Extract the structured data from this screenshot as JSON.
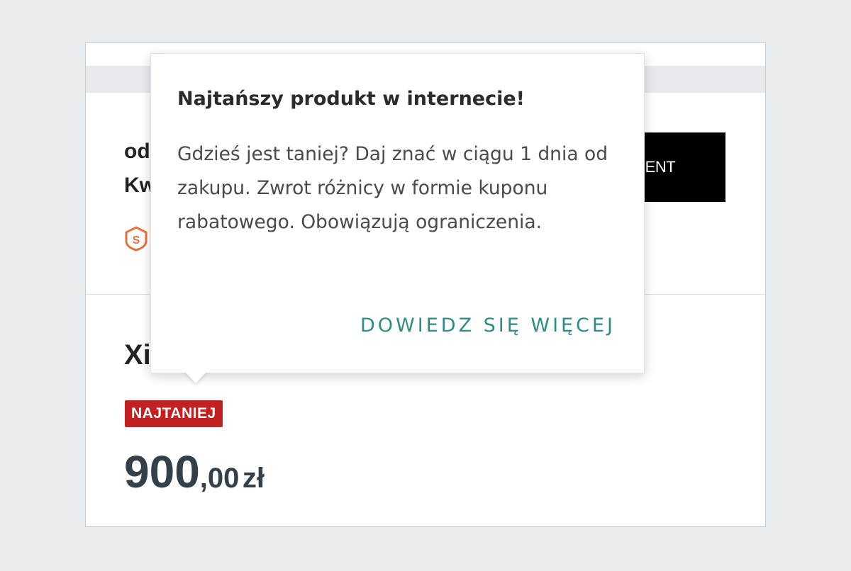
{
  "seller": {
    "line1": "od",
    "line2": "Kw",
    "badge_icon": "super-seller-shield-icon",
    "badge_letter": "S",
    "accent_color": "#e8703d"
  },
  "promo_button": {
    "label": "MENT"
  },
  "product": {
    "title": "Xi",
    "badge": "NAJTANIEJ",
    "badge_color": "#c22021",
    "price_integer": "900",
    "price_decimal": ",00",
    "currency": "zł"
  },
  "tooltip": {
    "title": "Najtańszy produkt w internecie!",
    "body": "Gdzieś jest taniej? Daj znać w ciągu 1 dnia od zakupu. Zwrot różnicy w formie kuponu rabatowego. Obowiązują ograniczenia.",
    "link": "DOWIEDZ SIĘ WIĘCEJ",
    "link_color": "#2f8c84"
  }
}
